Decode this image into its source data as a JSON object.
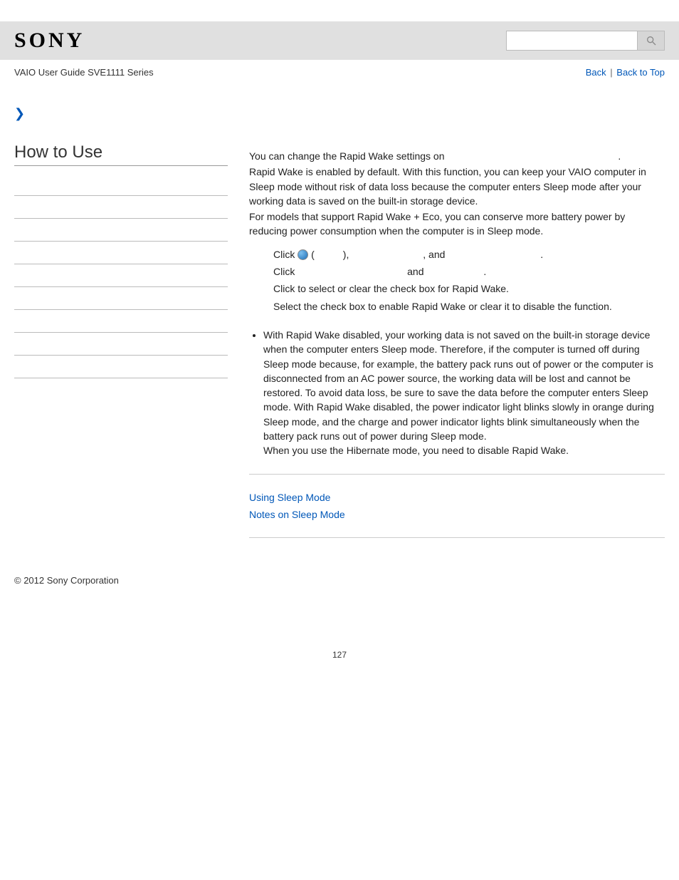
{
  "header": {
    "logo": "SONY",
    "search_placeholder": ""
  },
  "subheader": {
    "guide_title": "VAIO User Guide SVE1111 Series",
    "back": "Back",
    "sep": "|",
    "back_to_top": "Back to Top"
  },
  "sidebar": {
    "heading": "How to Use"
  },
  "main": {
    "intro_line1_a": "You can change the Rapid Wake settings on ",
    "intro_line1_b": ".",
    "intro_body": "Rapid Wake is enabled by default. With this function, you can keep your VAIO computer in Sleep mode without risk of data loss because the computer enters Sleep mode after your working data is saved on the built-in storage device.",
    "intro_eco": "For models that support Rapid Wake + Eco, you can conserve more battery power by reducing power consumption when the computer is in Sleep mode.",
    "step1_a": "Click ",
    "step1_b": " (",
    "step1_c": "), ",
    "step1_d": ", and ",
    "step1_e": ".",
    "step2_a": "Click ",
    "step2_b": " and ",
    "step2_c": ".",
    "step3": "Click to select or clear the check box for Rapid Wake.",
    "step3b": "Select the check box to enable Rapid Wake or clear it to disable the function.",
    "note1": "With Rapid Wake disabled, your working data is not saved on the built-in storage device when the computer enters Sleep mode. Therefore, if the computer is turned off during Sleep mode because, for example, the battery pack runs out of power or the computer is disconnected from an AC power source, the working data will be lost and cannot be restored. To avoid data loss, be sure to save the data before the computer enters Sleep mode. With Rapid Wake disabled, the power indicator light blinks slowly in orange during Sleep mode, and the charge and power indicator lights blink simultaneously when the battery pack runs out of power during Sleep mode.",
    "note1b": "When you use the Hibernate mode, you need to disable Rapid Wake.",
    "related1": "Using Sleep Mode",
    "related2": "Notes on Sleep Mode"
  },
  "footer": {
    "copyright": "© 2012 Sony Corporation",
    "page": "127"
  }
}
